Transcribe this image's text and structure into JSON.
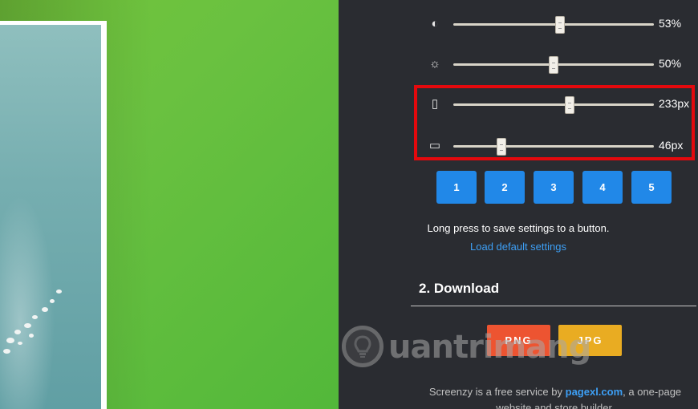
{
  "sliders": [
    {
      "icon": "contrast-icon",
      "glyph": "◐",
      "value_label": "53%",
      "fraction": 0.53
    },
    {
      "icon": "brightness-icon",
      "glyph": "☼",
      "value_label": "50%",
      "fraction": 0.5
    },
    {
      "icon": "horizontal-padding-icon",
      "glyph": "▯",
      "value_label": "233px",
      "fraction": 0.58
    },
    {
      "icon": "vertical-padding-icon",
      "glyph": "▭",
      "value_label": "46px",
      "fraction": 0.24
    }
  ],
  "presets": [
    "1",
    "2",
    "3",
    "4",
    "5"
  ],
  "hint": "Long press to save settings to a button.",
  "defaults_link": "Load default settings",
  "download": {
    "title": "2. Download",
    "png_label": "PNG",
    "jpg_label": "JPG"
  },
  "footer": {
    "prefix": "Screenzy is a free service by ",
    "link": "pagexl.com",
    "suffix": ", a one-page website and store builder."
  },
  "watermark": "uantrimang",
  "colors": {
    "accent_blue": "#2188e8",
    "png_red": "#ed5431",
    "jpg_orange": "#e9ac22",
    "highlight_red": "#e4090d",
    "panel_bg": "#2a2c31"
  }
}
